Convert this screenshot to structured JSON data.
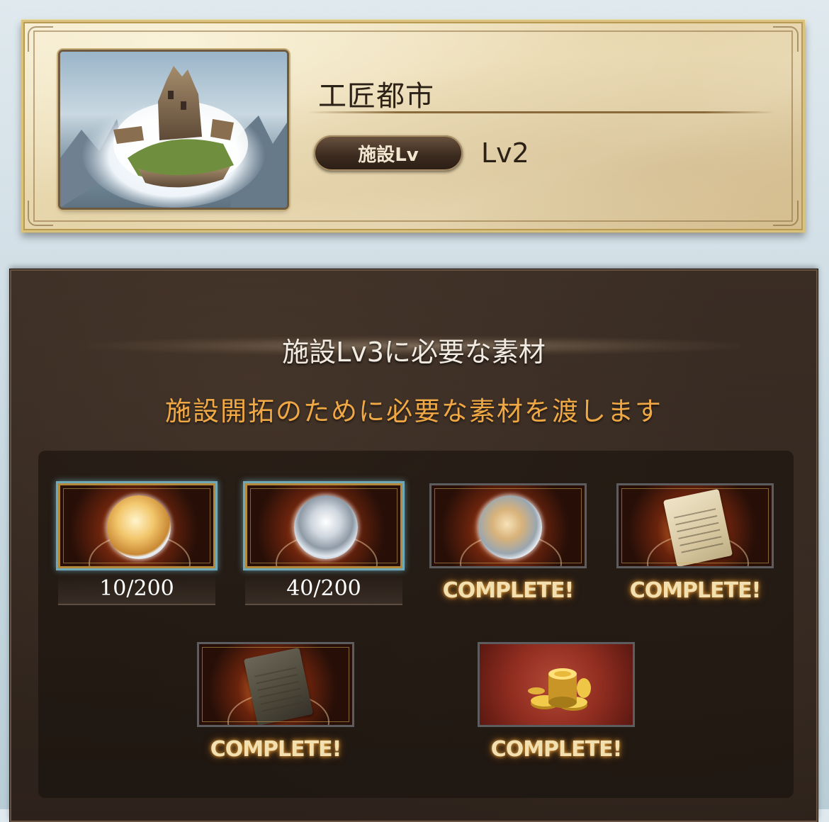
{
  "facility": {
    "title": "工匠都市",
    "badge_label": "施設Lv",
    "level": "Lv2",
    "thumbnail": "floating-island-city-image"
  },
  "requirements": {
    "heading": "施設Lv3に必要な素材",
    "notice": "施設開拓のために必要な素材を渡します",
    "notice_color": "#f0a845",
    "items": [
      {
        "icon": "gold-haired-character-orb",
        "status": "10/200",
        "selected": true
      },
      {
        "icon": "silver-haired-character-orb",
        "status": "40/200",
        "selected": true
      },
      {
        "icon": "character-orb",
        "status": "COMPLETE!",
        "selected": false
      },
      {
        "icon": "scroll-icon",
        "status": "COMPLETE!",
        "selected": false
      },
      {
        "icon": "dark-scroll-icon",
        "status": "COMPLETE!",
        "selected": false
      },
      {
        "icon": "gold-coins-icon",
        "status": "COMPLETE!",
        "selected": false
      }
    ]
  }
}
